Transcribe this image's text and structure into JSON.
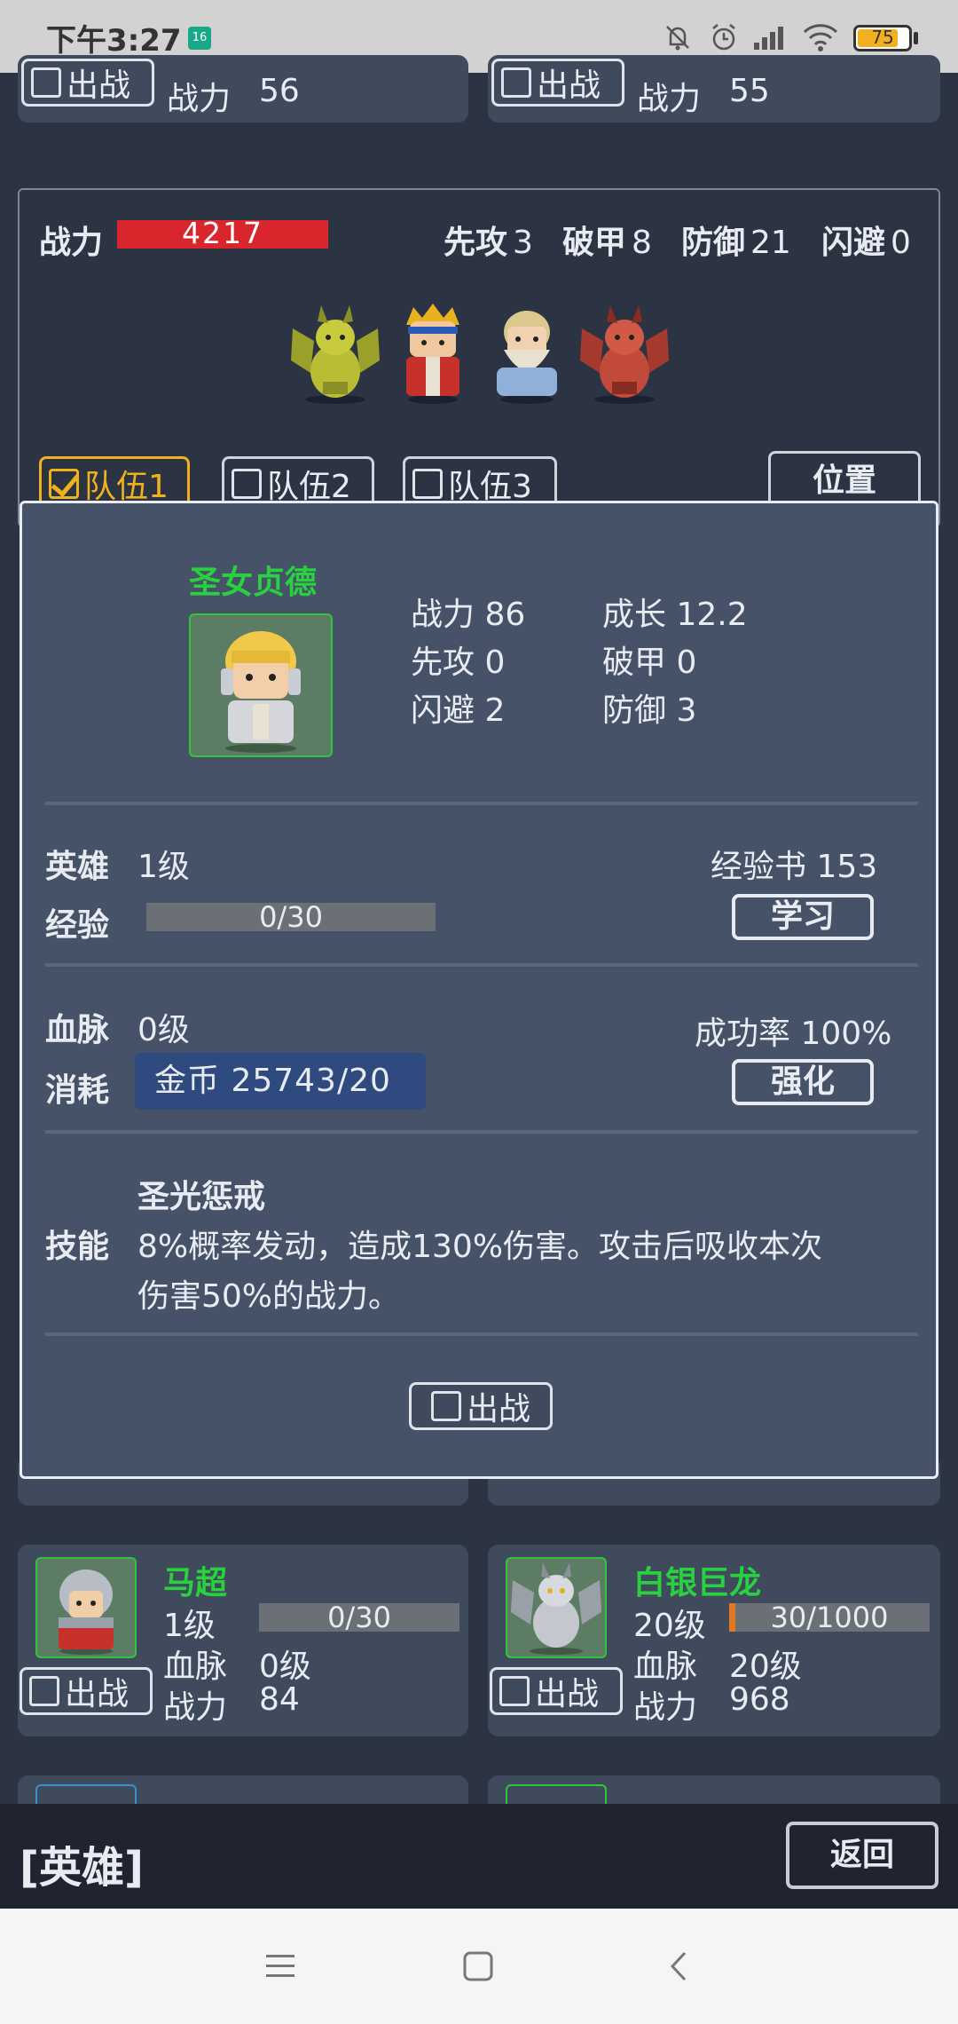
{
  "status_bar": {
    "time": "下午3:27",
    "notification_badge": "16",
    "battery": "75",
    "battery_level": 0.75
  },
  "top_cards": [
    {
      "deploy_label": "出战",
      "power_label": "战力",
      "power": "56"
    },
    {
      "deploy_label": "出战",
      "power_label": "战力",
      "power": "55"
    }
  ],
  "team": {
    "power_label": "战力",
    "power": "4217",
    "stats": [
      {
        "label": "先攻",
        "value": "3"
      },
      {
        "label": "破甲",
        "value": "8"
      },
      {
        "label": "防御",
        "value": "21"
      },
      {
        "label": "闪避",
        "value": "0"
      }
    ],
    "tabs": [
      {
        "label": "队伍1",
        "checked": true
      },
      {
        "label": "队伍2",
        "checked": false
      },
      {
        "label": "队伍3",
        "checked": false
      }
    ],
    "position_button": "位置"
  },
  "hero_detail": {
    "name": "圣女贞德",
    "stats": [
      {
        "label": "战力",
        "value": "86"
      },
      {
        "label": "成长",
        "value": "12.2"
      },
      {
        "label": "先攻",
        "value": "0"
      },
      {
        "label": "破甲",
        "value": "0"
      },
      {
        "label": "闪避",
        "value": "2"
      },
      {
        "label": "防御",
        "value": "3"
      }
    ],
    "hero_label": "英雄",
    "hero_level": "1级",
    "exp_book_label": "经验书",
    "exp_book_count": "153",
    "exp_label": "经验",
    "exp_value": "0/30",
    "exp_progress": 0,
    "learn_button": "学习",
    "blood_label": "血脉",
    "blood_level": "0级",
    "success_label": "成功率",
    "success_rate": "100%",
    "cost_label": "消耗",
    "cost_value": "金币 25743/20",
    "enhance_button": "强化",
    "skill_label": "技能",
    "skill_name": "圣光惩戒",
    "skill_desc_line1": "8%概率发动，造成130%伤害。攻击后吸收本次",
    "skill_desc_line2": "伤害50%的战力。",
    "deploy_label": "出战"
  },
  "hero_cards": [
    {
      "name": "马超",
      "level": "1级",
      "exp": "0/30",
      "exp_progress": 0,
      "blood_label": "血脉",
      "blood": "0级",
      "power_label": "战力",
      "power": "84",
      "deploy_label": "出战"
    },
    {
      "name": "白银巨龙",
      "level": "20级",
      "exp": "30/1000",
      "exp_progress": 0.03,
      "blood_label": "血脉",
      "blood": "20级",
      "power_label": "战力",
      "power": "968",
      "deploy_label": "出战"
    }
  ],
  "bottom_bar": {
    "title": "[英雄]",
    "back_button": "返回"
  },
  "colors": {
    "background": "#2c3444",
    "card": "#3f4a5d",
    "modal": "#465267",
    "hero_name": "#29d13e",
    "power_bar": "#d9262c",
    "active_tab": "#f0b21c",
    "coin_box": "#2e4a7e"
  }
}
